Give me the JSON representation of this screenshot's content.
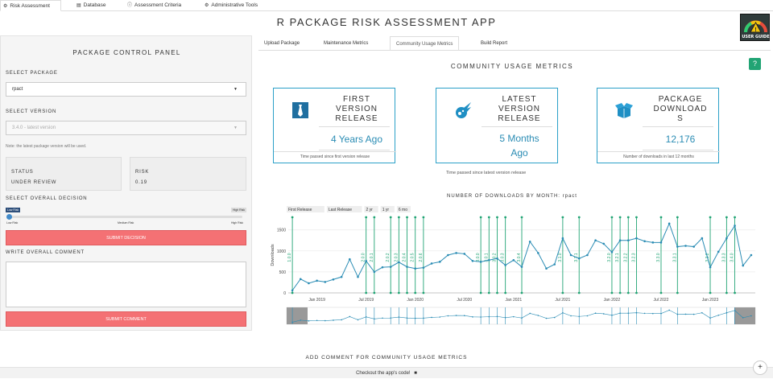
{
  "nav": {
    "tabs": [
      {
        "label": "Risk Assessment",
        "icon": "sliders-icon"
      },
      {
        "label": "Database",
        "icon": "database-icon"
      },
      {
        "label": "Assessment Criteria",
        "icon": "info-circle-icon"
      },
      {
        "label": "Administrative Tools",
        "icon": "user-gear-icon"
      }
    ]
  },
  "header": {
    "title": "R PACKAGE RISK ASSESSMENT APP",
    "user_guide": "USER GUIDE"
  },
  "panel": {
    "title": "PACKAGE CONTROL PANEL",
    "select_package_label": "SELECT PACKAGE",
    "package_value": "rpact",
    "select_version_label": "SELECT VERSION",
    "version_value": "3.4.0 - latest version",
    "note": "Note: the latest package version will be used.",
    "status_label": "STATUS",
    "status_value": "UNDER REVIEW",
    "risk_label": "RISK",
    "risk_value": "0.19",
    "decision_label": "SELECT OVERALL DECISION",
    "slider": {
      "min": "Low Risk",
      "max": "High Risk",
      "ticks": [
        "Low Risk",
        "Medium Risk",
        "High Risk"
      ],
      "value": "Low Risk"
    },
    "submit_decision": "SUBMIT DECISION",
    "comment_label": "WRITE OVERALL COMMENT",
    "submit_comment": "SUBMIT COMMENT"
  },
  "main": {
    "tabs": [
      "Upload Package",
      "Maintenance Metrics",
      "Community Usage Metrics",
      "Build Report"
    ],
    "active_tab": "Community Usage Metrics",
    "section_title": "COMMUNITY USAGE METRICS",
    "cards": [
      {
        "icon": "tie-icon",
        "title_lines": [
          "FIRST",
          "VERSION",
          "RELEASE"
        ],
        "value_lines": [
          "4 Years Ago"
        ],
        "footer": "Time passed since first version release",
        "below": ""
      },
      {
        "icon": "meteor-icon",
        "title_lines": [
          "LATEST",
          "VERSION",
          "RELEASE"
        ],
        "value_lines": [
          "5 Months",
          "Ago"
        ],
        "footer": "",
        "below": "Time passed since latest version release"
      },
      {
        "icon": "box-open-icon",
        "title_lines": [
          "PACKAGE",
          "DOWNLOAD",
          "S"
        ],
        "value_lines": [
          "12,176"
        ],
        "footer": "Number of downloads in last 12 months",
        "below": ""
      }
    ],
    "bottom_title": "ADD COMMENT FOR COMMUNITY USAGE METRICS"
  },
  "colors": {
    "accent": "#2a8cb4",
    "card_border": "#2ba0c8",
    "button_red": "#f47174",
    "release_line": "#21a474",
    "help_green": "#21a474"
  },
  "footer": {
    "text": "Checkout the app's code!",
    "icon": "github-icon"
  },
  "chart_data": {
    "type": "line",
    "title": "NUMBER OF DOWNLOADS BY MONTH: rpact",
    "ylabel": "Downloads",
    "xlabel": "",
    "ylim": [
      0,
      1800
    ],
    "yticks": [
      0,
      500,
      1000,
      1500
    ],
    "xticks": [
      "Jan 2019",
      "Jul 2019",
      "Jan 2020",
      "Jul 2020",
      "Jan 2021",
      "Jul 2021",
      "Jan 2022",
      "Jul 2022",
      "Jan 2023"
    ],
    "range_buttons": [
      "First Release",
      "Last Release",
      "2 yr",
      "1 yr",
      "6 mo"
    ],
    "x_start": "2018-10",
    "x": [
      "2018-10",
      "2018-11",
      "2018-12",
      "2019-01",
      "2019-02",
      "2019-03",
      "2019-04",
      "2019-05",
      "2019-06",
      "2019-07",
      "2019-08",
      "2019-09",
      "2019-10",
      "2019-11",
      "2019-12",
      "2020-01",
      "2020-02",
      "2020-03",
      "2020-04",
      "2020-05",
      "2020-06",
      "2020-07",
      "2020-08",
      "2020-09",
      "2020-10",
      "2020-11",
      "2020-12",
      "2021-01",
      "2021-02",
      "2021-03",
      "2021-04",
      "2021-05",
      "2021-06",
      "2021-07",
      "2021-08",
      "2021-09",
      "2021-10",
      "2021-11",
      "2021-12",
      "2022-01",
      "2022-02",
      "2022-03",
      "2022-04",
      "2022-05",
      "2022-06",
      "2022-07",
      "2022-08",
      "2022-09",
      "2022-10",
      "2022-11",
      "2022-12",
      "2023-01",
      "2023-02",
      "2023-03",
      "2023-04",
      "2023-05",
      "2023-06"
    ],
    "values": [
      60,
      330,
      230,
      290,
      260,
      320,
      380,
      800,
      380,
      760,
      500,
      610,
      620,
      730,
      620,
      580,
      600,
      700,
      740,
      900,
      950,
      930,
      760,
      740,
      780,
      820,
      660,
      780,
      620,
      1220,
      950,
      580,
      680,
      1300,
      900,
      820,
      900,
      1250,
      1170,
      970,
      1250,
      1250,
      1300,
      1230,
      1200,
      1200,
      1650,
      1100,
      1120,
      1100,
      1300,
      610,
      980,
      1300,
      1600,
      650,
      900,
      1400,
      1020,
      1050,
      980
    ],
    "releases": [
      {
        "label": "1.0.0",
        "x": "2018-10"
      },
      {
        "label": "2.0.0",
        "x": "2019-07"
      },
      {
        "label": "2.0.1",
        "x": "2019-08"
      },
      {
        "label": "2.0.2",
        "x": "2019-10"
      },
      {
        "label": "2.0.3",
        "x": "2019-11"
      },
      {
        "label": "2.0.4",
        "x": "2019-12"
      },
      {
        "label": "2.0.5",
        "x": "2020-01"
      },
      {
        "label": "2.0.6",
        "x": "2020-02"
      },
      {
        "label": "3.0.0",
        "x": "2020-09"
      },
      {
        "label": "3.0.1",
        "x": "2020-10"
      },
      {
        "label": "3.0.2",
        "x": "2020-11"
      },
      {
        "label": "3.0.3",
        "x": "2020-12"
      },
      {
        "label": "3.0.4",
        "x": "2021-02"
      },
      {
        "label": "3.1.0",
        "x": "2021-07"
      },
      {
        "label": "3.1.1",
        "x": "2021-09"
      },
      {
        "label": "3.2.0",
        "x": "2022-01"
      },
      {
        "label": "3.2.1",
        "x": "2022-02"
      },
      {
        "label": "3.2.2",
        "x": "2022-03"
      },
      {
        "label": "3.2.3",
        "x": "2022-04"
      },
      {
        "label": "3.3.0",
        "x": "2022-07"
      },
      {
        "label": "3.3.1",
        "x": "2022-09"
      },
      {
        "label": "3.3.2",
        "x": "2023-01"
      },
      {
        "label": "3.3.3",
        "x": "2023-03"
      },
      {
        "label": "3.4.0",
        "x": "2023-04"
      }
    ]
  }
}
